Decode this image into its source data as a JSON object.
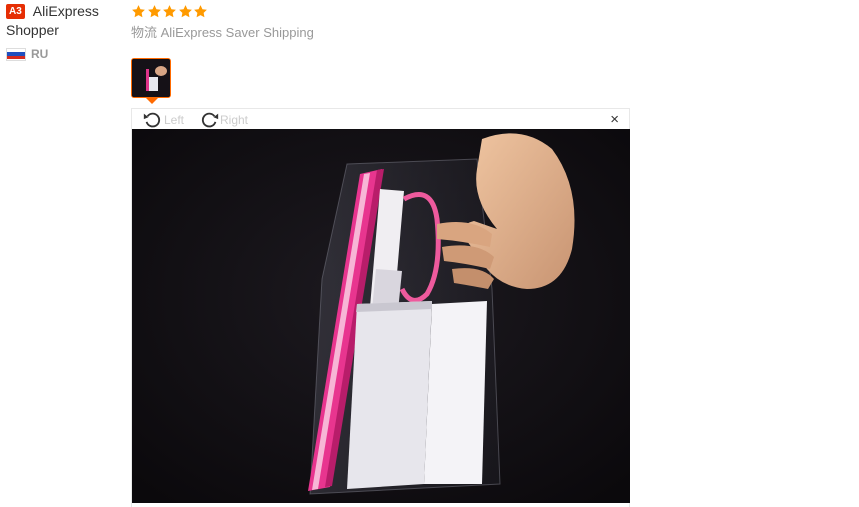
{
  "reviewer": {
    "badge": "A3",
    "name": "AliExpress Shopper",
    "country_code": "RU"
  },
  "review": {
    "rating": 5,
    "shipping_label": "物流",
    "shipping_method": "AliExpress Saver Shipping"
  },
  "viewer": {
    "rotate_left_label": "Left",
    "rotate_right_label": "Right",
    "close_symbol": "×"
  },
  "colors": {
    "star": "#ff9a00",
    "badge": "#e62e04",
    "thumb_border": "#ff6a00"
  }
}
